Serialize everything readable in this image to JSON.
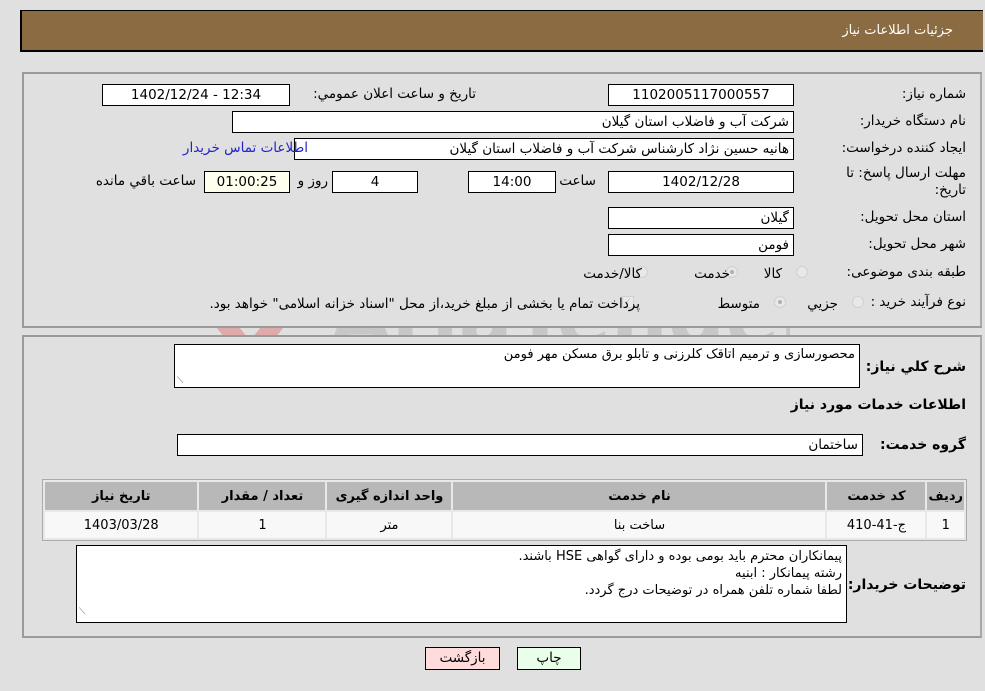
{
  "header": {
    "title": "جزئیات اطلاعات نیاز"
  },
  "details": {
    "need_number_label": "شماره نیاز:",
    "need_number": "1102005117000557",
    "announce_label": "تاریخ و ساعت اعلان عمومي:",
    "announce_value": "1402/12/24 - 12:34",
    "buyer_org_label": "نام دستگاه خریدار:",
    "buyer_org": "شرکت آب و فاضلاب استان گیلان",
    "creator_label": "ایجاد کننده درخواست:",
    "creator": "هانیه حسین نژاد کارشناس شرکت آب و فاضلاب استان گیلان",
    "contact_link": "اطلاعات تماس خریدار",
    "deadline_label": "مهلت ارسال پاسخ: تا تاریخ:",
    "deadline_date": "1402/12/28",
    "time_label": "ساعت",
    "deadline_time": "14:00",
    "days_value": "4",
    "days_label": "روز و",
    "remaining_time": "01:00:25",
    "remaining_label": "ساعت باقي مانده",
    "province_label": "استان محل تحویل:",
    "province": "گیلان",
    "city_label": "شهر محل تحویل:",
    "city": "فومن",
    "category_label": "طبقه بندی موضوعی:",
    "category_options": [
      "کالا",
      "خدمت",
      "کالا/خدمت"
    ],
    "category_selected": "خدمت",
    "process_label": "نوع فرآیند خرید :",
    "process_options": [
      "جزيي",
      "متوسط"
    ],
    "process_selected": "متوسط",
    "treasury_note": "پرداخت تمام یا بخشی از مبلغ خرید،از محل \"اسناد خزانه اسلامی\" خواهد بود."
  },
  "services": {
    "summary_label": "شرح كلي نياز:",
    "summary": "محصورسازی و ترمیم اتاقک کلرزنی و تابلو برق مسکن مهر فومن",
    "section_title": "اطلاعات خدمات مورد نیاز",
    "group_label": "گروه خدمت:",
    "group": "ساختمان",
    "table": {
      "headers": [
        "ردیف",
        "کد خدمت",
        "نام خدمت",
        "واحد اندازه گیری",
        "تعداد / مقدار",
        "تاریخ نیاز"
      ],
      "rows": [
        [
          "1",
          "ج-41-410",
          "ساخت بنا",
          "متر",
          "1",
          "1403/03/28"
        ]
      ]
    },
    "buyer_notes_label": "توضیحات خریدار:",
    "buyer_notes": [
      "پیمانکاران محترم باید بومی بوده و دارای گواهی HSE  باشند.",
      "رشته پیمانکار :  ابنیه",
      "لطفا شماره تلفن همراه در توضیحات درج گردد."
    ]
  },
  "buttons": {
    "back": "بازگشت",
    "print": "چاپ"
  },
  "watermark": {
    "text": "AriaTender.neT"
  }
}
